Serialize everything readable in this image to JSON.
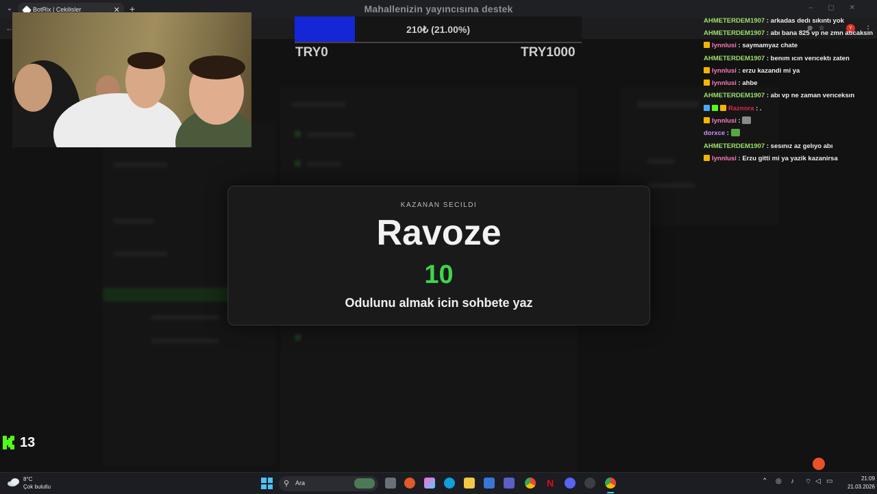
{
  "browser": {
    "tab_title": "BotRix | Cekilisler",
    "tab_close": "✕",
    "new_tab": "+",
    "profile_initial": "Y"
  },
  "header": {
    "title": "Mahallenizin yayıncısına destek"
  },
  "donation_goal": {
    "progress_text": "210₺ (21.00%)",
    "progress_fraction": 0.21,
    "min_label": "TRY0",
    "max_label": "TRY1000",
    "fill_color": "#1526d6"
  },
  "winner_modal": {
    "kicker": "KAZANAN SECILDI",
    "winner_name": "Ravoze",
    "number": "10",
    "instruction": "Odulunu almak icin sohbete yaz",
    "accent_color": "#3dd64b"
  },
  "chat": {
    "messages": [
      {
        "user": "AHMETERDEM1907",
        "text": ": arkadas dedı sıkıntı yok",
        "color": "#9de26a",
        "badges": []
      },
      {
        "user": "AHMETERDEM1907",
        "text": ": abı bana 825 vp ne zmn atıcaksın",
        "color": "#9de26a",
        "badges": []
      },
      {
        "user": "lynnlusi",
        "text": ": saymamyaz chate",
        "color": "#ff7ab8",
        "badges": [
          "crown"
        ]
      },
      {
        "user": "AHMETERDEM1907",
        "text": ": benım ıcın verıcektı zaten",
        "color": "#9de26a",
        "badges": []
      },
      {
        "user": "lynnlusi",
        "text": ": erzu kazandi mi ya",
        "color": "#ff7ab8",
        "badges": [
          "crown"
        ]
      },
      {
        "user": "lynnlusi",
        "text": ": ahbe",
        "color": "#ff7ab8",
        "badges": [
          "crown"
        ]
      },
      {
        "user": "AHMETERDEM1907",
        "text": ": abı vp ne zaman verıceksın",
        "color": "#9de26a",
        "badges": []
      },
      {
        "user": "Raznora",
        "text": ": .",
        "color": "#e3264a",
        "badges": [
          "blue",
          "green",
          "crown"
        ]
      },
      {
        "user": "lynnlusi",
        "text": ":",
        "color": "#ff7ab8",
        "badges": [
          "crown"
        ],
        "emote": "cat-emote"
      },
      {
        "user": "dorxce",
        "text": ":",
        "color": "#d48cff",
        "badges": [],
        "emote": "pepe-emote"
      },
      {
        "user": "AHMETERDEM1907",
        "text": ": sesınız az gelıyo abı",
        "color": "#9de26a",
        "badges": []
      },
      {
        "user": "lynnlusi",
        "text": ": Erzu gitti mi ya yazik kazanirsa",
        "color": "#ff7ab8",
        "badges": [
          "crown"
        ]
      }
    ]
  },
  "kick": {
    "viewer_count": "13",
    "brand_color": "#53fc18"
  },
  "taskbar": {
    "weather_temp": "8°C",
    "weather_desc": "Çok bulutlu",
    "search_placeholder": "Ara",
    "time": "21:09",
    "date": "21.03.2026"
  },
  "icons": [
    "weather-cloud-icon",
    "windows-start-icon",
    "search-icon",
    "file-explorer-icon",
    "edge-icon",
    "chrome-icon",
    "netflix-icon",
    "discord-icon",
    "steam-icon",
    "wifi-icon",
    "volume-icon"
  ]
}
